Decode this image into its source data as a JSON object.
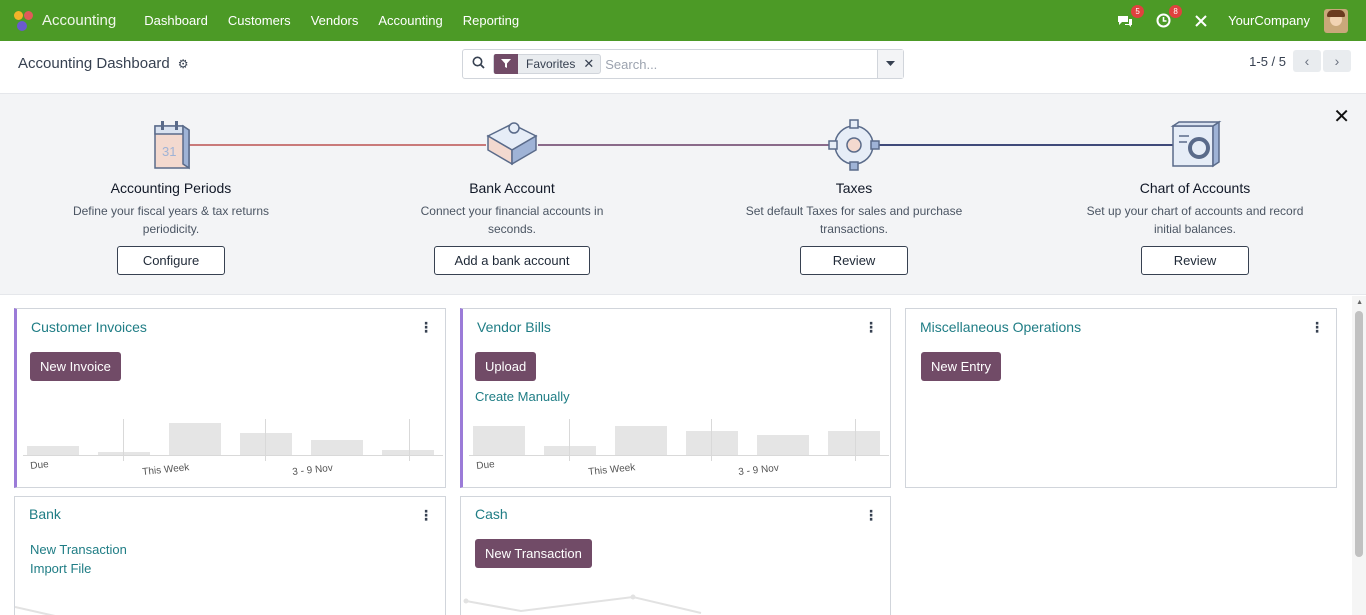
{
  "topnav": {
    "app_name": "Accounting",
    "menu": [
      "Dashboard",
      "Customers",
      "Vendors",
      "Accounting",
      "Reporting"
    ],
    "messages_count": "5",
    "activities_count": "8",
    "company": "YourCompany",
    "bg_color": "#4c9a26"
  },
  "control_panel": {
    "title": "Accounting Dashboard",
    "facet_label": "Favorites",
    "search_placeholder": "Search...",
    "pager": "1-5 / 5"
  },
  "onboarding": {
    "steps": [
      {
        "title": "Accounting Periods",
        "desc": "Define your fiscal years & tax returns periodicity.",
        "button": "Configure",
        "icon": "calendar-icon"
      },
      {
        "title": "Bank Account",
        "desc": "Connect your financial accounts in seconds.",
        "button": "Add a bank account",
        "icon": "puzzle-icon"
      },
      {
        "title": "Taxes",
        "desc": "Set default Taxes for sales and purchase transactions.",
        "button": "Review",
        "icon": "cog-icon"
      },
      {
        "title": "Chart of Accounts",
        "desc": "Set up your chart of accounts and record initial balances.",
        "button": "Review",
        "icon": "chart-accounts-icon"
      }
    ],
    "line_colors": [
      "#c97a7a",
      "#8a6a8a",
      "#3f4a7a"
    ]
  },
  "cards": {
    "customer_invoices": {
      "title": "Customer Invoices",
      "button": "New Invoice",
      "chart_labels": [
        "Due",
        "This Week",
        "3 - 9 Nov"
      ],
      "bars": [
        0.25,
        0.07,
        0.95,
        0.65,
        0.45,
        0.15
      ]
    },
    "vendor_bills": {
      "title": "Vendor Bills",
      "button": "Upload",
      "link": "Create Manually",
      "chart_labels": [
        "Due",
        "This Week",
        "3 - 9 Nov"
      ],
      "bars": [
        0.85,
        0.25,
        0.85,
        0.72,
        0.6,
        0.72
      ]
    },
    "misc": {
      "title": "Miscellaneous Operations",
      "button": "New Entry"
    },
    "bank": {
      "title": "Bank",
      "link1": "New Transaction",
      "link2": "Import File"
    },
    "cash": {
      "title": "Cash",
      "button": "New Transaction"
    }
  },
  "colors": {
    "primary": "#714b67",
    "link": "#1f7d85",
    "accent": "#9b7bd8"
  }
}
